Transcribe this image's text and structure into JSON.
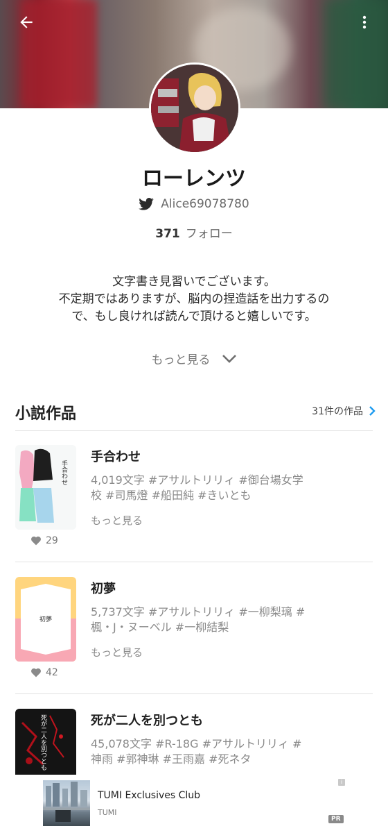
{
  "header": {
    "back_icon": "arrow-left-icon",
    "menu_icon": "more-vertical-icon"
  },
  "profile": {
    "name": "ローレンツ",
    "twitter_handle": "Alice69078780",
    "follow_count": "371",
    "follow_label": "フォロー",
    "bio_lines": [
      "文字書き見習いでございます。",
      "不定期ではありますが、脳内の捏造話を出力するの",
      "で、もし良ければ読んで頂けると嬉しいです。"
    ],
    "more_label": "もっと見る"
  },
  "novels": {
    "section_title": "小説作品",
    "count_link": "31件の作品",
    "items": [
      {
        "title": "手合わせ",
        "meta_lines": [
          "4,019文字 #アサルトリリィ #御台場女学",
          "校 #司馬燈 #船田純 #きいとも"
        ],
        "more": "もっと見る",
        "likes": "29",
        "cover_text": "手合わせ"
      },
      {
        "title": "初夢",
        "meta_lines": [
          "5,737文字 #アサルトリリィ #一柳梨璃 #",
          "楓・J・ヌーベル #一柳結梨"
        ],
        "more": "もっと見る",
        "likes": "42",
        "cover_text": "初夢"
      },
      {
        "title": "死が二人を別つとも",
        "meta_lines": [
          "45,078文字 #R-18G #アサルトリリィ #",
          "神雨 #郭神琳 #王雨嘉 #死ネタ"
        ],
        "cover_text": "死が二人を別つとも"
      }
    ]
  },
  "ad": {
    "title": "TUMI Exclusives Club",
    "sponsor": "TUMI",
    "badge": "PR",
    "info": "i"
  },
  "colors": {
    "accent_blue": "#1d9bf0",
    "text_gray": "#8a8a8a"
  }
}
